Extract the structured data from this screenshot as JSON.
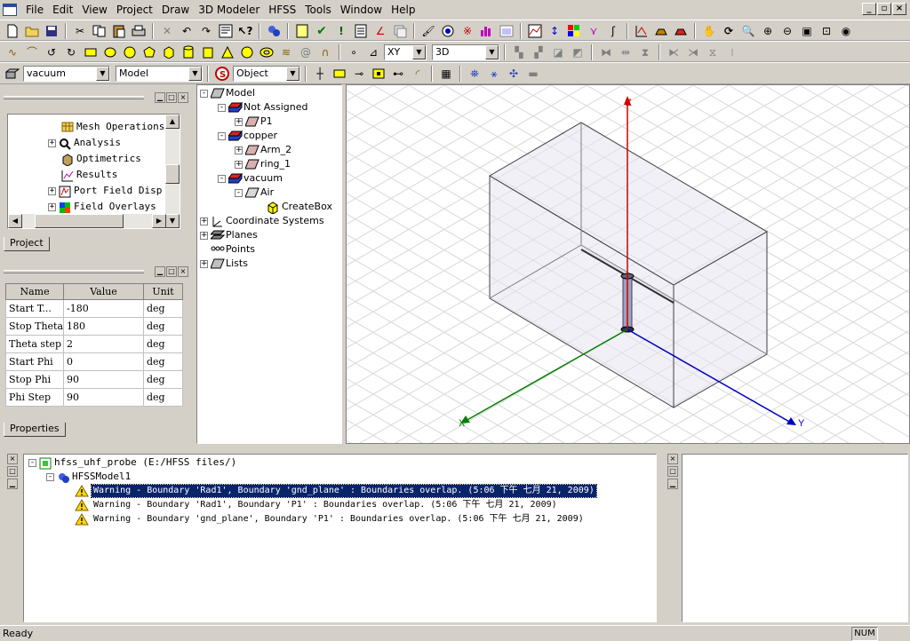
{
  "menubar": {
    "items": [
      "File",
      "Edit",
      "View",
      "Project",
      "Draw",
      "3D Modeler",
      "HFSS",
      "Tools",
      "Window",
      "Help"
    ],
    "window_controls": [
      "_",
      "▫",
      "×"
    ]
  },
  "toolbar2": {
    "plane_select": "XY",
    "view_select": "3D"
  },
  "toolbar3": {
    "material_select": "vacuum",
    "model_select": "Model",
    "select_mode": "Object"
  },
  "project_panel": {
    "tree": [
      {
        "label": "Mesh Operations",
        "expander": ""
      },
      {
        "label": "Analysis",
        "expander": "+"
      },
      {
        "label": "Optimetrics",
        "expander": ""
      },
      {
        "label": "Results",
        "expander": ""
      },
      {
        "label": "Port Field Disp",
        "expander": "+"
      },
      {
        "label": "Field Overlays",
        "expander": "+"
      }
    ],
    "tab_label": "Project"
  },
  "properties_panel": {
    "columns": [
      "Name",
      "Value",
      "Unit"
    ],
    "rows": [
      [
        "Start T...",
        "-180",
        "deg"
      ],
      [
        "Stop Theta",
        "180",
        "deg"
      ],
      [
        "Theta step",
        "2",
        "deg"
      ],
      [
        "Start Phi",
        "0",
        "deg"
      ],
      [
        "Stop Phi",
        "90",
        "deg"
      ],
      [
        "Phi Step",
        "90",
        "deg"
      ]
    ],
    "tab_label": "Properties"
  },
  "model_tree": {
    "items": [
      {
        "label": "Model",
        "expander": "-"
      },
      {
        "label": "Not Assigned",
        "expander": "-"
      },
      {
        "label": "P1",
        "expander": "+"
      },
      {
        "label": "copper",
        "expander": "-"
      },
      {
        "label": "Arm_2",
        "expander": "+"
      },
      {
        "label": "ring_1",
        "expander": "+"
      },
      {
        "label": "vacuum",
        "expander": "-"
      },
      {
        "label": "Air",
        "expander": "-"
      },
      {
        "label": "CreateBox",
        "expander": ""
      },
      {
        "label": "Coordinate Systems",
        "expander": "+"
      },
      {
        "label": "Planes",
        "expander": "+"
      },
      {
        "label": "Points",
        "expander": ""
      },
      {
        "label": "Lists",
        "expander": "+"
      }
    ]
  },
  "viewport": {
    "axis_z": "Z",
    "axis_y": "Y",
    "axis_x": "X",
    "colors": {
      "z": "#d00000",
      "y": "#0000c0",
      "x": "#008000",
      "grid": "#d6d6d6"
    }
  },
  "message_manager": {
    "project": "hfss_uhf_probe (E:/HFSS files/)",
    "design": "HFSSModel1",
    "messages": [
      "Warning - Boundary 'Rad1', Boundary 'gnd_plane' : Boundaries overlap. (5:06 下午  七月 21, 2009)",
      "Warning - Boundary 'Rad1', Boundary 'P1' : Boundaries overlap. (5:06 下午  七月 21, 2009)",
      "Warning - Boundary 'gnd_plane', Boundary 'P1' : Boundaries overlap. (5:06 下午  七月 21, 2009)"
    ]
  },
  "statusbar": {
    "text": "Ready",
    "num": "NUM"
  }
}
